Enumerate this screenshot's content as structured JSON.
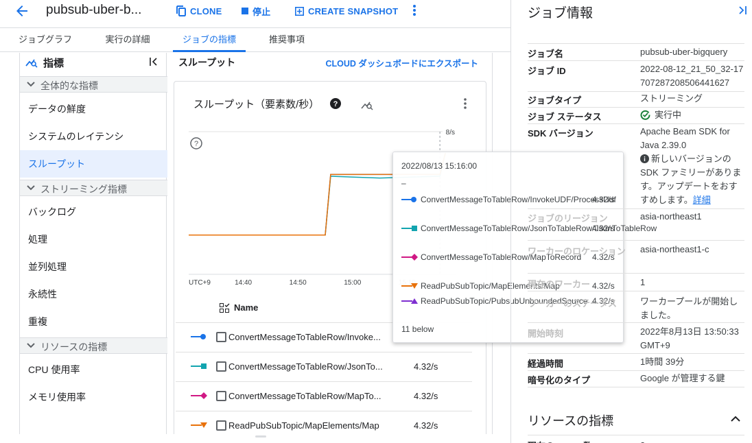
{
  "topbar": {
    "job_name": "pubsub-uber-b...",
    "clone_label": "CLONE",
    "stop_label": "停止",
    "snapshot_label": "CREATE SNAPSHOT"
  },
  "tabs": [
    {
      "label": "ジョブグラフ"
    },
    {
      "label": "実行の詳細"
    },
    {
      "label": "ジョブの指標"
    },
    {
      "label": "推奨事項"
    }
  ],
  "leftnav": {
    "title": "指標",
    "sections": [
      {
        "label": "全体的な指標",
        "items": [
          "データの鮮度",
          "システムのレイテンシ",
          "スループット"
        ]
      },
      {
        "label": "ストリーミング指標",
        "items": [
          "バックログ",
          "処理",
          "並列処理",
          "永続性",
          "重複"
        ]
      },
      {
        "label": "リソースの指標",
        "items": [
          "CPU 使用率",
          "メモリ使用率"
        ]
      }
    ]
  },
  "main": {
    "title": "スループット",
    "export_label": "CLOUD ダッシュボードにエクスポート",
    "chart_title": "スループット（要素数/秒）"
  },
  "chart_data": {
    "type": "line",
    "y_top_label": "8/s",
    "x_ticks": [
      "UTC+9",
      "14:40",
      "14:50",
      "15:00",
      "15:10"
    ],
    "series": [
      {
        "name": "ConvertMessageToTableRow/InvokeUDF/ProcessUdf",
        "color": "#1a73e8",
        "points": [
          [
            "14:30",
            2.2
          ],
          [
            "14:55",
            2.2
          ],
          [
            "14:56",
            5.6
          ],
          [
            "15:05",
            5.6
          ],
          [
            "15:16",
            5.6
          ],
          [
            "15:17",
            6.8
          ]
        ]
      },
      {
        "name": "ConvertMessageToTableRow/JsonToTableRow/JsonToTableRow",
        "color": "#12a4af",
        "points": [
          [
            "14:30",
            2.2
          ],
          [
            "14:55",
            2.2
          ],
          [
            "14:56",
            5.5
          ],
          [
            "15:05",
            5.4
          ],
          [
            "15:16",
            5.5
          ],
          [
            "15:17",
            6.8
          ]
        ]
      },
      {
        "name": "ReadPubSubTopic/MapElements/Map",
        "color": "#e8710a",
        "points": [
          [
            "14:30",
            2.2
          ],
          [
            "14:55",
            2.2
          ],
          [
            "14:56",
            5.6
          ],
          [
            "15:05",
            5.6
          ],
          [
            "15:16",
            5.6
          ],
          [
            "15:17",
            6.8
          ]
        ]
      }
    ]
  },
  "table": {
    "header_name": "Name",
    "rows": [
      {
        "name": "ConvertMessageToTableRow/Invoke...",
        "value": "4.32/s",
        "color": "#1a73e8",
        "marker": "circle"
      },
      {
        "name": "ConvertMessageToTableRow/JsonTo...",
        "value": "4.32/s",
        "color": "#12a4af",
        "marker": "square"
      },
      {
        "name": "ConvertMessageToTableRow/MapTo...",
        "value": "4.32/s",
        "color": "#d01884",
        "marker": "diamond"
      },
      {
        "name": "ReadPubSubTopic/MapElements/Map",
        "value": "4.32/s",
        "color": "#e8710a",
        "marker": "triangle-down"
      }
    ]
  },
  "tooltip": {
    "timestamp": "2022/08/13 15:16:00",
    "dash": "–",
    "rows": [
      {
        "name": "ConvertMessageToTableRow/InvokeUDF/ProcessUdf",
        "value": "4.32/s",
        "color": "#1a73e8",
        "marker": "circle"
      },
      {
        "name": "ConvertMessageToTableRow/JsonToTableRow/JsonToTableRow",
        "value": "4.32/s",
        "color": "#12a4af",
        "marker": "square"
      },
      {
        "name": "ConvertMessageToTableRow/MapToRecord",
        "value": "4.32/s",
        "color": "#d01884",
        "marker": "diamond"
      },
      {
        "name": "ReadPubSubTopic/MapElements/Map",
        "value": "4.32/s",
        "color": "#e8710a",
        "marker": "triangle-down"
      },
      {
        "name": "ReadPubSubTopic/PubsubUnboundedSource",
        "value": "4.32/s",
        "color": "#7e2fd0",
        "marker": "triangle-up"
      }
    ],
    "more": "11 below"
  },
  "right": {
    "title": "ジョブ情報",
    "job_name_label": "ジョブ名",
    "job_name": "pubsub-uber-bigquery",
    "job_id_label": "ジョブ ID",
    "job_id": "2022-08-12_21_50_32-17707287208506441627",
    "job_type_label": "ジョブタイプ",
    "job_type": "ストリーミング",
    "job_status_label": "ジョブ ステータス",
    "job_status": "実行中",
    "sdk_label": "SDK バージョン",
    "sdk": "Apache Beam SDK for Java 2.39.0",
    "sdk_note": "新しいバージョンの SDK ファミリーがあります。アップデートをおすすめします。",
    "sdk_link": "詳細",
    "region_label": "ジョブのリージョン",
    "region": "asia-northeast1",
    "worker_loc_label": "ワーカーのロケーション",
    "worker_loc": "asia-northeast1-c",
    "workers_label": "現在のワーカー",
    "workers": "1",
    "worker_status_label": "ワーカーのステータス",
    "worker_status": "ワーカープールが開始しました。",
    "start_label": "開始時刻",
    "start": "2022年8月13日 13:50:33 GMT+9",
    "elapsed_label": "経過時間",
    "elapsed": "1時間 39分",
    "enc_label": "暗号化のタイプ",
    "enc": "Google が管理する鍵",
    "resources_title": "リソースの指標",
    "vcpu_label": "現在の vCPU 数",
    "vcpu": "2"
  }
}
